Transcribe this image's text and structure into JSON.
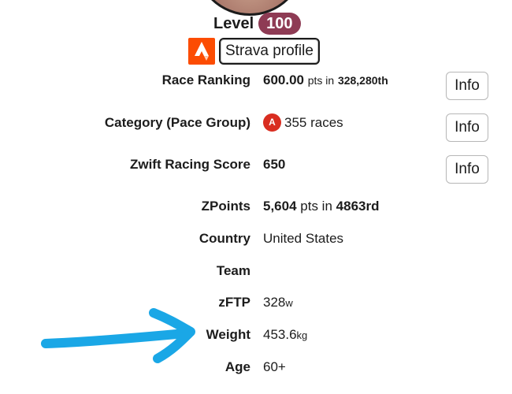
{
  "level": {
    "label": "Level",
    "value": "100"
  },
  "strava": {
    "button_label": "Strava profile",
    "logo": "strava-logo-icon"
  },
  "rows": {
    "race_ranking": {
      "label": "Race Ranking",
      "points": "600.00",
      "pts_text": "pts in",
      "rank": "328,280th",
      "info": "Info"
    },
    "category": {
      "label": "Category (Pace Group)",
      "badge": "A",
      "value": "355 races",
      "info": "Info"
    },
    "zrs": {
      "label": "Zwift Racing Score",
      "value": "650",
      "info": "Info"
    },
    "zpoints": {
      "label": "ZPoints",
      "points": "5,604",
      "pts_text": "pts in",
      "rank": "4863rd"
    },
    "country": {
      "label": "Country",
      "value": "United States"
    },
    "team": {
      "label": "Team",
      "value": ""
    },
    "zftp": {
      "label": "zFTP",
      "value": "328",
      "unit": "w"
    },
    "weight": {
      "label": "Weight",
      "value": "453.6",
      "unit": "kg"
    },
    "age": {
      "label": "Age",
      "value": "60+"
    }
  },
  "colors": {
    "level_badge": "#8e3b54",
    "strava_orange": "#fc4c02",
    "category_a": "#d92d20",
    "arrow": "#1aa7e6"
  }
}
